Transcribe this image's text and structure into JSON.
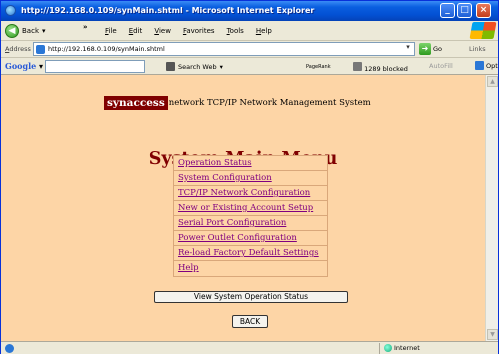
{
  "window": {
    "title": "http://192.168.0.109/synMain.shtml - Microsoft Internet Explorer"
  },
  "menubar": {
    "back_label": "Back",
    "items": [
      "File",
      "Edit",
      "View",
      "Favorites",
      "Tools",
      "Help"
    ]
  },
  "addressbar": {
    "label": "Address",
    "url": "http://192.168.0.109/synMain.shtml",
    "go_label": "Go",
    "links_label": "Links"
  },
  "google_toolbar": {
    "logo": "Google",
    "search_web": "Search Web",
    "pagerank": "PageRank",
    "blocked": "1289 blocked",
    "autofill": "AutoFill",
    "options": "Opt"
  },
  "page": {
    "brand": "synaccess",
    "brand_suffix": "network TCP/IP Network Management System",
    "title": "System Main Menu",
    "menu_links": [
      "Operation Status",
      "System Configuration",
      "TCP/IP Network Configuration",
      "New or Existing Account Setup",
      "Serial Port Configuration",
      "Power Outlet Configuration",
      "Re-load Factory Default Settings",
      "Help"
    ],
    "view_button": "View System Operation Status",
    "back_button": "BACK"
  },
  "statusbar": {
    "zone": "Internet"
  },
  "colors": {
    "page_background": "#fdd5a6",
    "title_color": "#800000",
    "brand_box": "#800000",
    "link_color": "#800080"
  }
}
